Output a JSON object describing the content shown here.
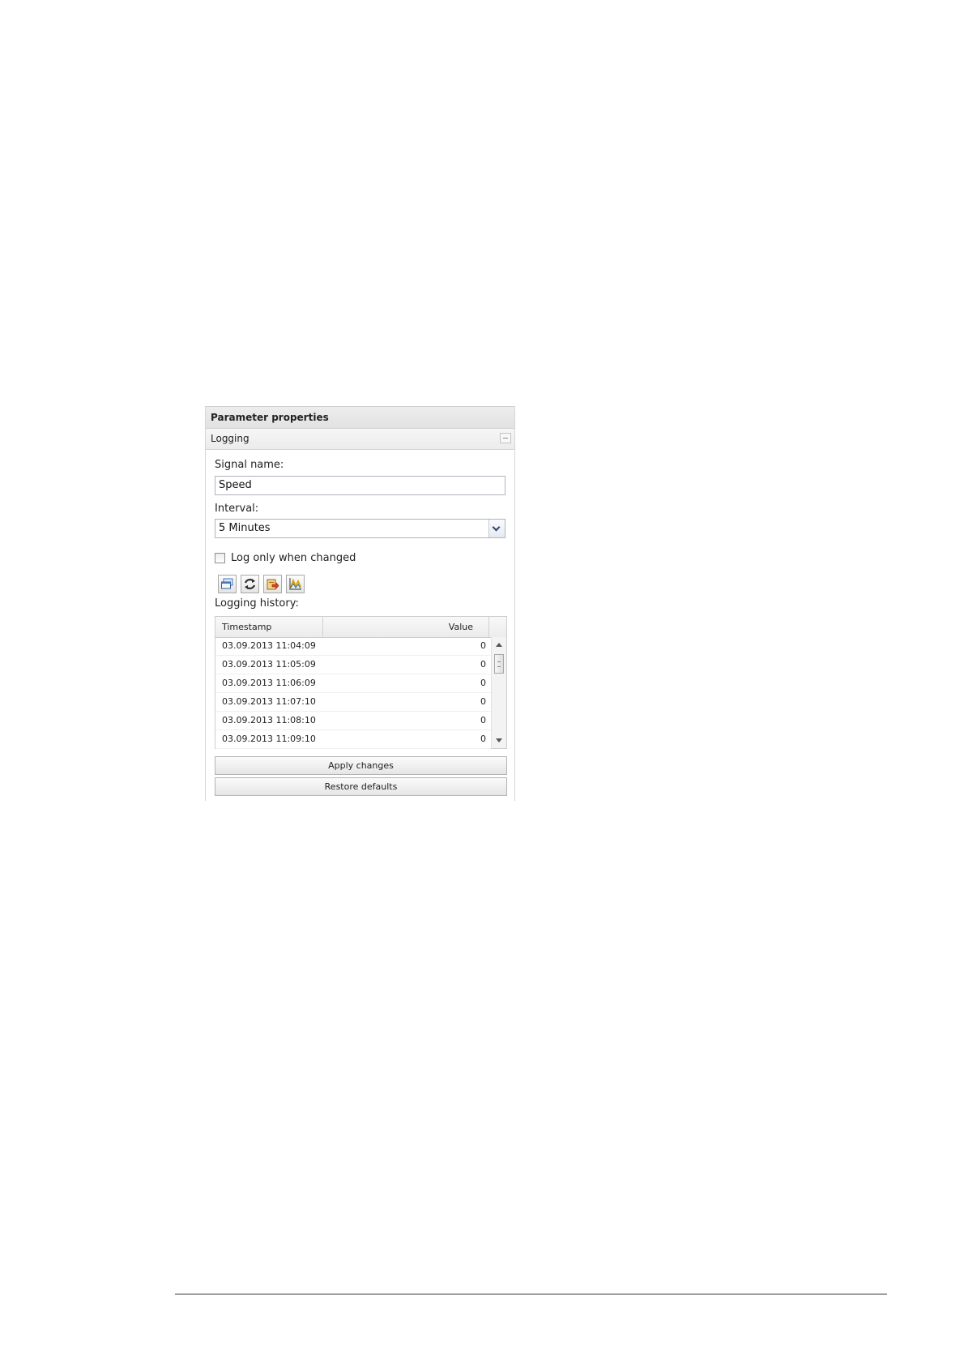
{
  "panel": {
    "title": "Parameter properties",
    "section": "Logging"
  },
  "form": {
    "signal_label": "Signal name:",
    "signal_value": "Speed",
    "interval_label": "Interval:",
    "interval_value": "5 Minutes",
    "log_changed_label": "Log only when changed",
    "log_changed_checked": false,
    "history_label": "Logging history:"
  },
  "toolbar": {
    "icons": [
      "window-icon",
      "refresh-icon",
      "export-icon",
      "chart-icon"
    ]
  },
  "history": {
    "columns": [
      "Timestamp",
      "Value"
    ],
    "rows": [
      [
        "03.09.2013 11:04:09",
        "0"
      ],
      [
        "03.09.2013 11:05:09",
        "0"
      ],
      [
        "03.09.2013 11:06:09",
        "0"
      ],
      [
        "03.09.2013 11:07:10",
        "0"
      ],
      [
        "03.09.2013 11:08:10",
        "0"
      ],
      [
        "03.09.2013 11:09:10",
        "0"
      ]
    ]
  },
  "actions": {
    "apply_label": "Apply changes",
    "restore_label": "Restore defaults"
  }
}
